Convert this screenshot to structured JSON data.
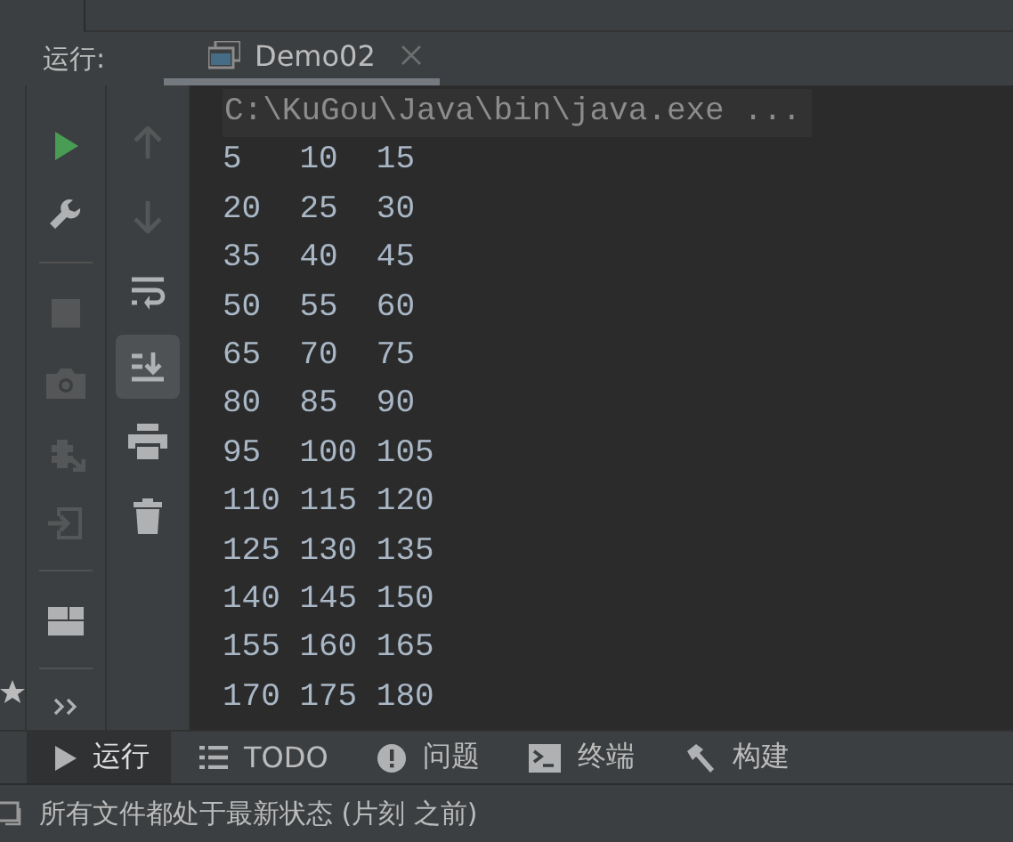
{
  "run_panel": {
    "label": "运行:",
    "tabs": [
      {
        "label": "Demo02",
        "selected": true,
        "closable": true
      }
    ]
  },
  "left_toolbar": [
    {
      "kind": "run",
      "disabled": false
    },
    {
      "kind": "wrench",
      "disabled": false
    },
    {
      "kind": "separator"
    },
    {
      "kind": "stop",
      "disabled": true
    },
    {
      "kind": "camera",
      "disabled": true
    },
    {
      "kind": "bug",
      "disabled": true
    },
    {
      "kind": "login",
      "disabled": true
    },
    {
      "kind": "separator"
    },
    {
      "kind": "layout",
      "disabled": false
    },
    {
      "kind": "separator"
    },
    {
      "kind": "more",
      "disabled": false
    }
  ],
  "right_toolbar": [
    {
      "kind": "up",
      "disabled": true,
      "selected": false
    },
    {
      "kind": "down",
      "disabled": true,
      "selected": false
    },
    {
      "kind": "wrap",
      "disabled": false,
      "selected": false
    },
    {
      "kind": "scroll-end",
      "disabled": false,
      "selected": true
    },
    {
      "kind": "print",
      "disabled": false,
      "selected": false
    },
    {
      "kind": "trash",
      "disabled": false,
      "selected": false
    }
  ],
  "console": {
    "command": "C:\\KuGou\\Java\\bin\\java.exe ...",
    "lines": [
      "5   10  15",
      "20  25  30",
      "35  40  45",
      "50  55  60",
      "65  70  75",
      "80  85  90",
      "95  100 105",
      "110 115 120",
      "125 130 135",
      "140 145 150",
      "155 160 165",
      "170 175 180"
    ]
  },
  "bottom_tabs": [
    {
      "kind": "play",
      "label": "运行",
      "selected": true
    },
    {
      "kind": "list",
      "label": "TODO",
      "selected": false
    },
    {
      "kind": "alert",
      "label": "问题",
      "selected": false
    },
    {
      "kind": "terminal",
      "label": "终端",
      "selected": false
    },
    {
      "kind": "hammer",
      "label": "构建",
      "selected": false
    }
  ],
  "status_bar": {
    "text": "所有文件都处于最新状态 (片刻 之前)"
  }
}
